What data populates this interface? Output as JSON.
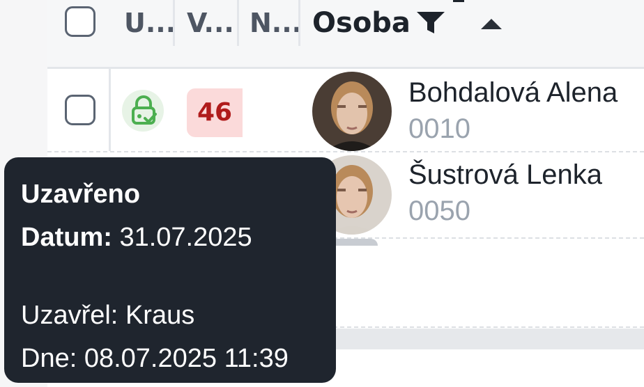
{
  "table": {
    "columns": {
      "col1": "U...",
      "col2": "V...",
      "col3": "N...",
      "osoba": "Osoba"
    },
    "rows": [
      {
        "badge": "46",
        "name": "Bohdalová Alena",
        "code": "0010"
      },
      {
        "name": "Šustrová Lenka",
        "code": "0050"
      }
    ]
  },
  "tooltip": {
    "status": "Uzavřeno",
    "date_label": "Datum:",
    "date_value": "31.07.2025",
    "closed_by_label": "Uzavřel:",
    "closed_by_value": "Kraus",
    "on_label": "Dne:",
    "on_value": "08.07.2025 11:39"
  },
  "colors": {
    "tooltip_bg": "#1f252e",
    "badge_bg": "#fbdada",
    "badge_text": "#b01b1b",
    "lock_green": "#4caf50"
  },
  "icons": [
    "filter-icon",
    "sort-ascending-icon",
    "lock-check-icon"
  ]
}
